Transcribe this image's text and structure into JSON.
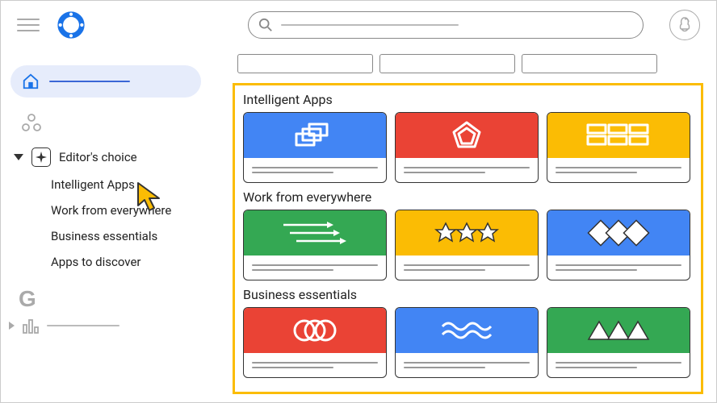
{
  "sidebar": {
    "editors_choice": "Editor's choice",
    "sub_items": [
      "Intelligent Apps",
      "Work from everywhere",
      "Business essentials",
      "Apps to discover"
    ]
  },
  "sections": [
    {
      "title": "Intelligent Apps",
      "cards": [
        {
          "bg": "blue",
          "icon": "stacked-squares"
        },
        {
          "bg": "red",
          "icon": "pentagon"
        },
        {
          "bg": "yellow",
          "icon": "grid-blocks"
        }
      ]
    },
    {
      "title": "Work from everywhere",
      "cards": [
        {
          "bg": "green",
          "icon": "arrows"
        },
        {
          "bg": "yellow",
          "icon": "stars"
        },
        {
          "bg": "blue",
          "icon": "diamonds"
        }
      ]
    },
    {
      "title": "Business essentials",
      "cards": [
        {
          "bg": "red",
          "icon": "rings"
        },
        {
          "bg": "blue",
          "icon": "waves"
        },
        {
          "bg": "green",
          "icon": "triangles"
        }
      ]
    }
  ]
}
